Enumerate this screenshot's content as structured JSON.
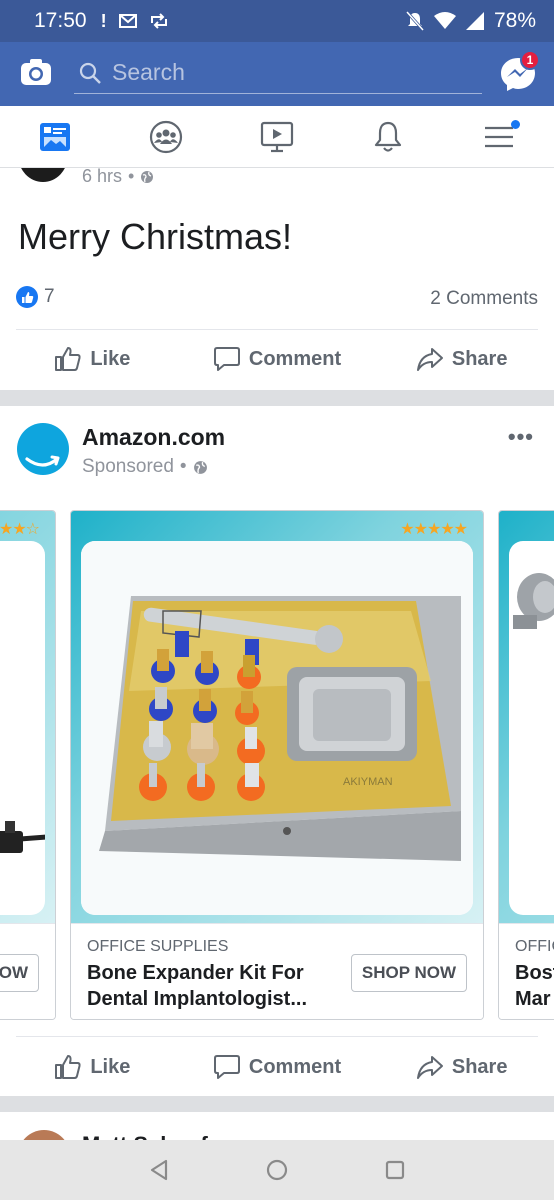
{
  "status_bar": {
    "time": "17:50",
    "battery": "78%",
    "icons": [
      "alert-icon",
      "gmail-icon",
      "sync-icon",
      "mute-icon",
      "wifi-icon",
      "signal-icon"
    ]
  },
  "header": {
    "search_placeholder": "Search",
    "messenger_badge": "1",
    "colors": {
      "status_bar": "#3b5998",
      "header": "#4267b2"
    }
  },
  "nav_tabs": [
    "news-feed-icon",
    "groups-icon",
    "watch-icon",
    "notifications-icon",
    "menu-icon"
  ],
  "post1": {
    "time": "6 hrs",
    "text": "Merry Christmas!",
    "like_count": "7",
    "comments": "2 Comments",
    "actions": {
      "like": "Like",
      "comment": "Comment",
      "share": "Share"
    }
  },
  "ad_post": {
    "advertiser": "Amazon.com",
    "sponsored": "Sponsored",
    "more": "•••",
    "cards": [
      {
        "category": "",
        "title": "",
        "button": "OW",
        "stars": "★★★☆"
      },
      {
        "category": "OFFICE SUPPLIES",
        "title": "Bone Expander Kit For Dental Implantologist...",
        "button": "SHOP NOW",
        "stars": "★★★★★"
      },
      {
        "category": "OFFIC",
        "title": "Bost Mar",
        "button": "",
        "stars": ""
      }
    ],
    "actions": {
      "like": "Like",
      "comment": "Comment",
      "share": "Share"
    }
  },
  "post3": {
    "name": "Matt Schoof"
  }
}
